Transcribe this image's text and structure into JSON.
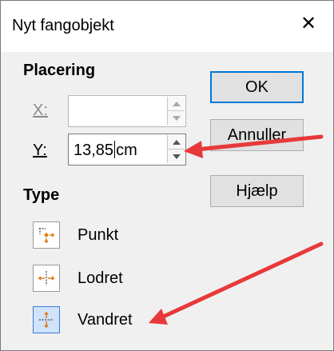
{
  "dialog": {
    "title": "Nyt fangobjekt",
    "close_symbol": "✕"
  },
  "placement": {
    "heading": "Placering",
    "x_label": "X:",
    "x_value": "",
    "y_label": "Y:",
    "y_value": "13,85",
    "y_unit": "cm"
  },
  "type": {
    "heading": "Type",
    "options": [
      {
        "label": "Punkt",
        "icon": "snap-point-icon",
        "selected": false
      },
      {
        "label": "Lodret",
        "icon": "snap-vertical-icon",
        "selected": false
      },
      {
        "label": "Vandret",
        "icon": "snap-horizontal-icon",
        "selected": true
      }
    ]
  },
  "buttons": {
    "ok": "OK",
    "cancel": "Annuller",
    "help": "Hjælp"
  },
  "annotation": {
    "arrow_color": "#e8393a"
  }
}
